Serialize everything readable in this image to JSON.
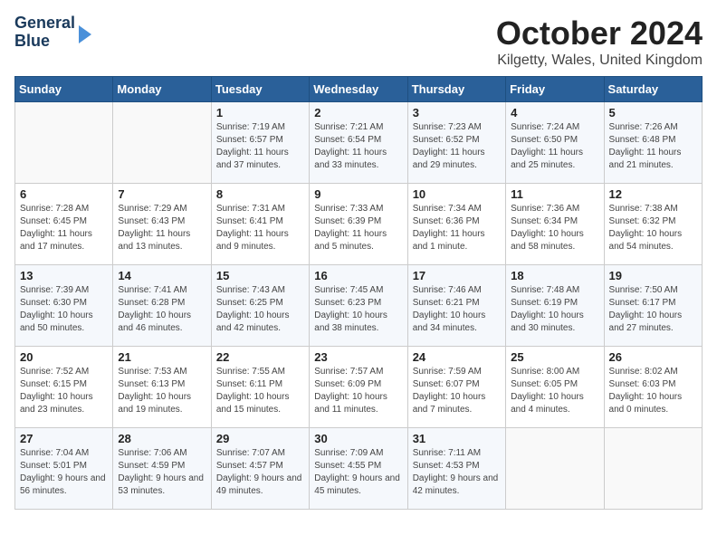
{
  "header": {
    "logo_line1": "General",
    "logo_line2": "Blue",
    "month": "October 2024",
    "location": "Kilgetty, Wales, United Kingdom"
  },
  "days_of_week": [
    "Sunday",
    "Monday",
    "Tuesday",
    "Wednesday",
    "Thursday",
    "Friday",
    "Saturday"
  ],
  "weeks": [
    [
      {
        "day": "",
        "info": ""
      },
      {
        "day": "",
        "info": ""
      },
      {
        "day": "1",
        "info": "Sunrise: 7:19 AM\nSunset: 6:57 PM\nDaylight: 11 hours and 37 minutes."
      },
      {
        "day": "2",
        "info": "Sunrise: 7:21 AM\nSunset: 6:54 PM\nDaylight: 11 hours and 33 minutes."
      },
      {
        "day": "3",
        "info": "Sunrise: 7:23 AM\nSunset: 6:52 PM\nDaylight: 11 hours and 29 minutes."
      },
      {
        "day": "4",
        "info": "Sunrise: 7:24 AM\nSunset: 6:50 PM\nDaylight: 11 hours and 25 minutes."
      },
      {
        "day": "5",
        "info": "Sunrise: 7:26 AM\nSunset: 6:48 PM\nDaylight: 11 hours and 21 minutes."
      }
    ],
    [
      {
        "day": "6",
        "info": "Sunrise: 7:28 AM\nSunset: 6:45 PM\nDaylight: 11 hours and 17 minutes."
      },
      {
        "day": "7",
        "info": "Sunrise: 7:29 AM\nSunset: 6:43 PM\nDaylight: 11 hours and 13 minutes."
      },
      {
        "day": "8",
        "info": "Sunrise: 7:31 AM\nSunset: 6:41 PM\nDaylight: 11 hours and 9 minutes."
      },
      {
        "day": "9",
        "info": "Sunrise: 7:33 AM\nSunset: 6:39 PM\nDaylight: 11 hours and 5 minutes."
      },
      {
        "day": "10",
        "info": "Sunrise: 7:34 AM\nSunset: 6:36 PM\nDaylight: 11 hours and 1 minute."
      },
      {
        "day": "11",
        "info": "Sunrise: 7:36 AM\nSunset: 6:34 PM\nDaylight: 10 hours and 58 minutes."
      },
      {
        "day": "12",
        "info": "Sunrise: 7:38 AM\nSunset: 6:32 PM\nDaylight: 10 hours and 54 minutes."
      }
    ],
    [
      {
        "day": "13",
        "info": "Sunrise: 7:39 AM\nSunset: 6:30 PM\nDaylight: 10 hours and 50 minutes."
      },
      {
        "day": "14",
        "info": "Sunrise: 7:41 AM\nSunset: 6:28 PM\nDaylight: 10 hours and 46 minutes."
      },
      {
        "day": "15",
        "info": "Sunrise: 7:43 AM\nSunset: 6:25 PM\nDaylight: 10 hours and 42 minutes."
      },
      {
        "day": "16",
        "info": "Sunrise: 7:45 AM\nSunset: 6:23 PM\nDaylight: 10 hours and 38 minutes."
      },
      {
        "day": "17",
        "info": "Sunrise: 7:46 AM\nSunset: 6:21 PM\nDaylight: 10 hours and 34 minutes."
      },
      {
        "day": "18",
        "info": "Sunrise: 7:48 AM\nSunset: 6:19 PM\nDaylight: 10 hours and 30 minutes."
      },
      {
        "day": "19",
        "info": "Sunrise: 7:50 AM\nSunset: 6:17 PM\nDaylight: 10 hours and 27 minutes."
      }
    ],
    [
      {
        "day": "20",
        "info": "Sunrise: 7:52 AM\nSunset: 6:15 PM\nDaylight: 10 hours and 23 minutes."
      },
      {
        "day": "21",
        "info": "Sunrise: 7:53 AM\nSunset: 6:13 PM\nDaylight: 10 hours and 19 minutes."
      },
      {
        "day": "22",
        "info": "Sunrise: 7:55 AM\nSunset: 6:11 PM\nDaylight: 10 hours and 15 minutes."
      },
      {
        "day": "23",
        "info": "Sunrise: 7:57 AM\nSunset: 6:09 PM\nDaylight: 10 hours and 11 minutes."
      },
      {
        "day": "24",
        "info": "Sunrise: 7:59 AM\nSunset: 6:07 PM\nDaylight: 10 hours and 7 minutes."
      },
      {
        "day": "25",
        "info": "Sunrise: 8:00 AM\nSunset: 6:05 PM\nDaylight: 10 hours and 4 minutes."
      },
      {
        "day": "26",
        "info": "Sunrise: 8:02 AM\nSunset: 6:03 PM\nDaylight: 10 hours and 0 minutes."
      }
    ],
    [
      {
        "day": "27",
        "info": "Sunrise: 7:04 AM\nSunset: 5:01 PM\nDaylight: 9 hours and 56 minutes."
      },
      {
        "day": "28",
        "info": "Sunrise: 7:06 AM\nSunset: 4:59 PM\nDaylight: 9 hours and 53 minutes."
      },
      {
        "day": "29",
        "info": "Sunrise: 7:07 AM\nSunset: 4:57 PM\nDaylight: 9 hours and 49 minutes."
      },
      {
        "day": "30",
        "info": "Sunrise: 7:09 AM\nSunset: 4:55 PM\nDaylight: 9 hours and 45 minutes."
      },
      {
        "day": "31",
        "info": "Sunrise: 7:11 AM\nSunset: 4:53 PM\nDaylight: 9 hours and 42 minutes."
      },
      {
        "day": "",
        "info": ""
      },
      {
        "day": "",
        "info": ""
      }
    ]
  ]
}
